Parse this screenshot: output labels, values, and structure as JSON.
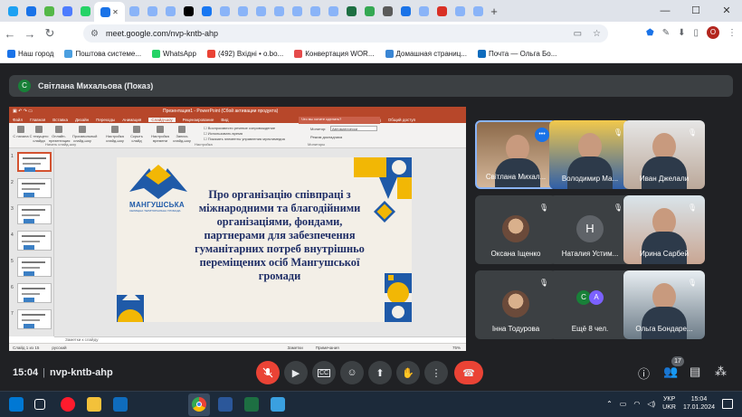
{
  "browser": {
    "tab_colors": [
      "#1da1f2",
      "#1a73e8",
      "#54b848",
      "#4d7cfe",
      "#25d366",
      "#1a73e8",
      "#8ab4f8",
      "#8ab4f8",
      "#8ab4f8",
      "#010101",
      "#1877f2",
      "#8ab4f8",
      "#8ab4f8",
      "#8ab4f8",
      "#8ab4f8",
      "#8ab4f8",
      "#8ab4f8",
      "#8ab4f8",
      "#1d6f42",
      "#34a853",
      "#5a5a5a",
      "#1a73e8",
      "#8ab4f8",
      "#d93025",
      "#8ab4f8",
      "#8ab4f8"
    ],
    "active_tab_close": "✕",
    "new_tab": "+",
    "url": "meet.google.com/nvp-kntb-ahp",
    "profile_initial": "O",
    "bookmarks": [
      {
        "label": "Наш город",
        "color": "#1a73e8"
      },
      {
        "label": "Поштова системе...",
        "color": "#4b9fe0"
      },
      {
        "label": "WhatsApp",
        "color": "#25d366"
      },
      {
        "label": "(492) Вхідні • o.bo...",
        "color": "#ea4335"
      },
      {
        "label": "Конвертация WOR...",
        "color": "#e54b4b"
      },
      {
        "label": "Домашная страниц...",
        "color": "#3a86d4"
      },
      {
        "label": "Почта — Ольга Бо...",
        "color": "#0f6cbd"
      }
    ]
  },
  "meet": {
    "presenter_initial": "С",
    "presenter_label": "Світлана Михальова (Показ)",
    "meeting_time": "15:04",
    "meeting_code": "nvp-kntb-ahp",
    "people_count": "17",
    "tiles": [
      {
        "name": "Світлана Михал...",
        "kind": "video"
      },
      {
        "name": "Володимир Ма...",
        "kind": "video"
      },
      {
        "name": "Иван Джелали",
        "kind": "video"
      },
      {
        "name": "Оксана Іщенко",
        "kind": "avatar"
      },
      {
        "name": "Наталия Устим...",
        "kind": "letter",
        "letter": "Н",
        "color": "#5f6368"
      },
      {
        "name": "Ирина Сарбей",
        "kind": "video"
      },
      {
        "name": "Інна Тодурова",
        "kind": "avatar"
      },
      {
        "name": "Ещё 8 чел.",
        "kind": "more",
        "letters": [
          "С",
          "А"
        ]
      },
      {
        "name": "Ольга Бондаре...",
        "kind": "video"
      }
    ]
  },
  "powerpoint": {
    "title_bar": "Презентация1 - PowerPoint (Сбой активации продукта)",
    "search_placeholder": "Что вы хотите сделать?",
    "share_label": "Общий доступ",
    "sign_in": "Вход",
    "menu": [
      "Файл",
      "Главная",
      "Вставка",
      "Дизайн",
      "Переходы",
      "Анимация",
      "Слайд-шоу",
      "Рецензирование",
      "Вид"
    ],
    "active_menu_index": 6,
    "ribbon_buttons": [
      "С начала",
      "С текущего слайда",
      "Онлайн-презентация",
      "Произвольный слайд-шоу",
      "Настройка слайд-шоу",
      "Скрыть слайд",
      "Настройка времени",
      "Запись слайд-шоу"
    ],
    "ribbon_group_1": "Начать слайд-шоу",
    "ribbon_group_2": "Настройка",
    "ribbon_group_3": "Мониторы",
    "ribbon_checks": [
      "Воспроизвести речевое сопровождение",
      "Использовать время",
      "Показать элементы управления мультимедиа"
    ],
    "ribbon_monitor": "Монитор:",
    "ribbon_monitor_value": "Автоматически",
    "ribbon_presenter": "Режим докладчика",
    "slide_count": 7,
    "slide_text": "Про організацію співпраці з міжнародними та благодійними організаціями, фондами, партнерами для забезпечення гуманітарних потреб внутрішньо переміщених осіб Мангушської громади",
    "logo_name": "МАНГУШСЬКА",
    "logo_sub": "СЕЛИЩНА ТЕРИТОРІАЛЬНА ГРОМАДА",
    "notes_placeholder": "Заметки к слайду",
    "status_slide": "Слайд 1 из 15",
    "status_lang": "русский",
    "status_notes": "Заметки",
    "status_comments": "Примечания",
    "zoom": "75%"
  },
  "taskbar": {
    "apps": [
      {
        "name": "windows-start",
        "color": "#0078d4"
      },
      {
        "name": "task-view",
        "color": "#1c2a3a"
      },
      {
        "name": "opera",
        "color": "#ff1b2d"
      },
      {
        "name": "explorer",
        "color": "#f3c13a"
      },
      {
        "name": "outlook",
        "color": "#0f6cbd"
      },
      {
        "name": "chrome",
        "color": "#4285f4"
      },
      {
        "name": "word",
        "color": "#2b579a"
      },
      {
        "name": "excel",
        "color": "#1d6f42"
      },
      {
        "name": "notepad",
        "color": "#3aa0e0"
      }
    ],
    "lang_top": "УКР",
    "lang_bottom": "UKR",
    "time": "15:04",
    "date": "17.01.2024"
  }
}
